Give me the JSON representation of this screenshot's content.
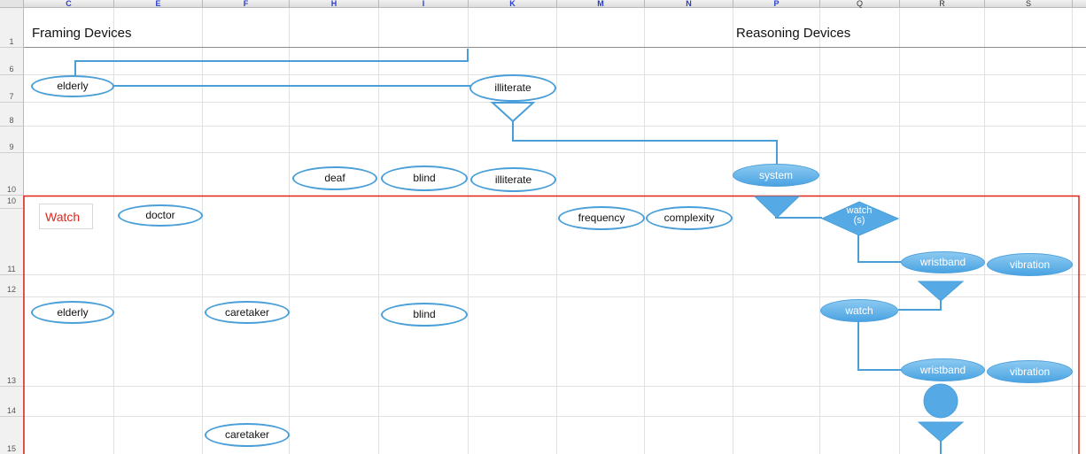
{
  "spreadsheet": {
    "columns": [
      "C",
      "E",
      "F",
      "H",
      "I",
      "K",
      "M",
      "N",
      "P",
      "Q",
      "R",
      "S"
    ],
    "rows": [
      "1",
      "6",
      "7",
      "8",
      "9",
      "10",
      "10",
      "11",
      "12",
      "13",
      "14",
      "15"
    ]
  },
  "cells": {
    "framing_devices": "Framing Devices",
    "reasoning_devices": "Reasoning Devices",
    "watch_label": "Watch"
  },
  "ovals": {
    "elderly_row7": "elderly",
    "illiterate_row7": "illiterate",
    "deaf": "deaf",
    "blind_row10": "blind",
    "illiterate_row10": "illiterate",
    "doctor": "doctor",
    "frequency": "frequency",
    "complexity": "complexity",
    "elderly_row12": "elderly",
    "caretaker_row12": "caretaker",
    "blind_row12": "blind",
    "caretaker_row15": "caretaker"
  },
  "filled_shapes": {
    "system": "system",
    "watch_s": "watch\n(s)",
    "wristband_1": "wristband",
    "vibration_1": "vibration",
    "watch": "watch",
    "wristband_2": "wristband",
    "vibration_2": "vibration"
  },
  "colors": {
    "connector": "#4a9fd8",
    "fill_light": "#8ccaf1",
    "fill_dark": "#4aa3e2",
    "selection_border": "#e0261b",
    "column_header_text": "#2a3ec8"
  }
}
